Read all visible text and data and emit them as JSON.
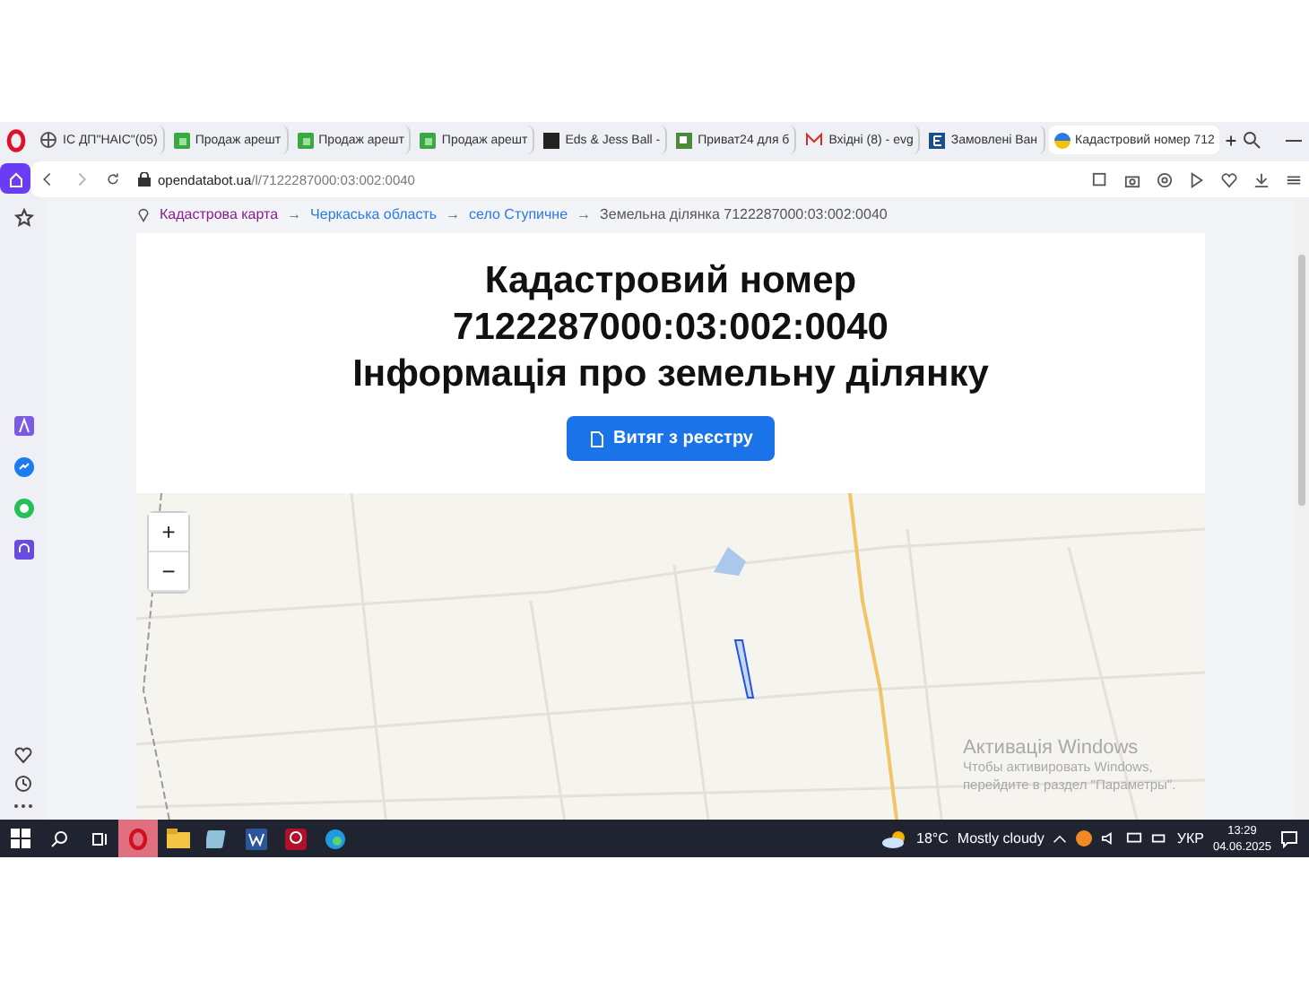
{
  "browser": {
    "tabs": [
      {
        "title": "ІС ДП\"НАІС\"(05)",
        "kind": "globe",
        "selected": false
      },
      {
        "title": "Продаж арешт",
        "kind": "square",
        "selected": false
      },
      {
        "title": "Продаж арешт",
        "kind": "square",
        "selected": false
      },
      {
        "title": "Продаж арешт",
        "kind": "square",
        "selected": false
      },
      {
        "title": "Eds & Jess Ball -",
        "kind": "dark",
        "selected": false
      },
      {
        "title": "Приват24 для б",
        "kind": "privat",
        "selected": false
      },
      {
        "title": "Вхідні (8) - evg",
        "kind": "mail",
        "selected": false
      },
      {
        "title": "Замовлені Ван",
        "kind": "letter",
        "selected": false
      },
      {
        "title": "Кадастровий номер 712",
        "kind": "ua",
        "selected": true
      }
    ],
    "address": {
      "host": "opendatabot.ua",
      "path": "/l/7122287000:03:002:0040"
    }
  },
  "breadcrumb": {
    "separator": "→",
    "items": [
      {
        "label": "Кадастрова карта",
        "kind": "visited"
      },
      {
        "label": "Черкаська область",
        "kind": "link"
      },
      {
        "label": "село Ступичне",
        "kind": "link"
      },
      {
        "label": "Земельна ділянка 7122287000:03:002:0040",
        "kind": "current"
      }
    ]
  },
  "heading": [
    "Кадастровий номер",
    "7122287000:03:002:0040",
    "Інформація про земельну ділянку"
  ],
  "extract_button": "Витяг з реєстру",
  "map": {
    "zoom_in": "+",
    "zoom_out": "−"
  },
  "activation": {
    "title": "Активація Windows",
    "text": "Чтобы активировать Windows, перейдите в раздел \"Параметры\"."
  },
  "taskbar": {
    "apps": [
      {
        "kind": "opera",
        "active": true
      },
      {
        "kind": "folder",
        "active": false
      },
      {
        "kind": "notes",
        "active": false
      },
      {
        "kind": "word",
        "active": false
      },
      {
        "kind": "red",
        "active": false
      },
      {
        "kind": "edge",
        "active": false
      }
    ],
    "temperature": "18°C",
    "weather": "Mostly cloudy",
    "language": "УКР",
    "time": "13:29",
    "date": "04.06.2025"
  }
}
